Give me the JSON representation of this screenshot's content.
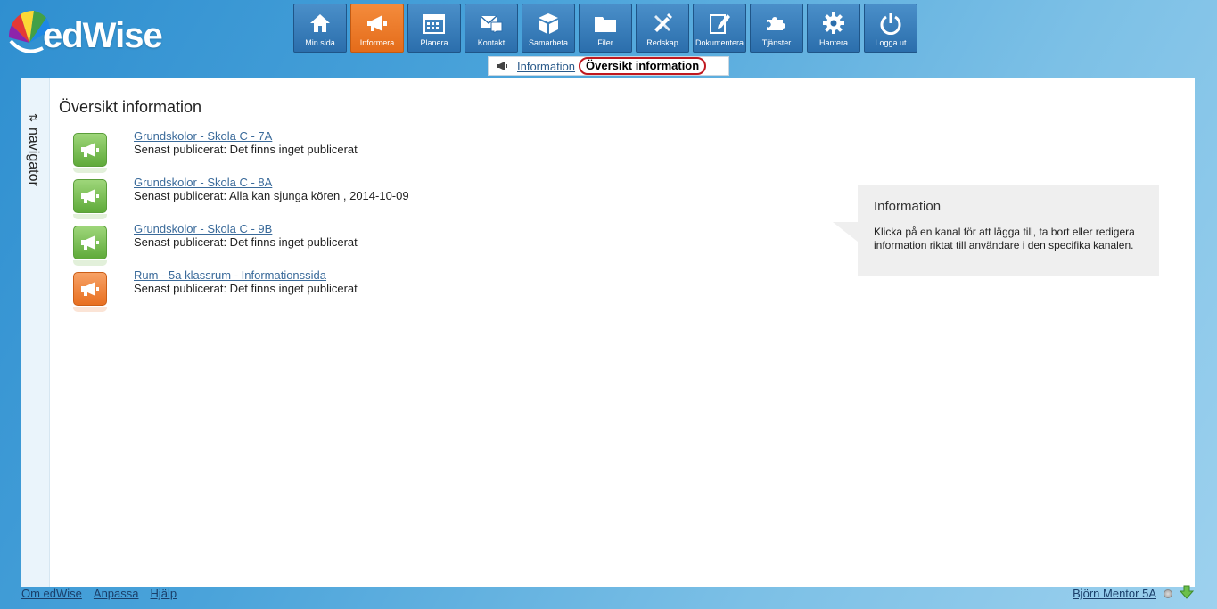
{
  "app": {
    "logo_text": "edWise"
  },
  "topnav": [
    {
      "label": "Min sida",
      "icon": "home-icon",
      "active": false
    },
    {
      "label": "Informera",
      "icon": "megaphone-icon",
      "active": true
    },
    {
      "label": "Planera",
      "icon": "calendar-icon",
      "active": false
    },
    {
      "label": "Kontakt",
      "icon": "mail-icon",
      "active": false
    },
    {
      "label": "Samarbeta",
      "icon": "cube-icon",
      "active": false
    },
    {
      "label": "Filer",
      "icon": "folder-icon",
      "active": false
    },
    {
      "label": "Redskap",
      "icon": "tools-icon",
      "active": false
    },
    {
      "label": "Dokumentera",
      "icon": "edit-document-icon",
      "active": false
    },
    {
      "label": "Tjänster",
      "icon": "puzzle-icon",
      "active": false
    },
    {
      "label": "Hantera",
      "icon": "gear-icon",
      "active": false
    },
    {
      "label": "Logga ut",
      "icon": "power-icon",
      "active": false
    }
  ],
  "breadcrumb": {
    "parent": "Information",
    "current": "Översikt information"
  },
  "navigator": {
    "label": "navigator"
  },
  "main": {
    "title": "Översikt information",
    "channels": [
      {
        "name": "Grundskolor - Skola C - 7A",
        "status": "Senast publicerat: Det finns inget publicerat",
        "color": "green"
      },
      {
        "name": "Grundskolor - Skola C - 8A",
        "status": "Senast publicerat: Alla kan sjunga kören , 2014-10-09",
        "color": "green"
      },
      {
        "name": "Grundskolor - Skola C - 9B",
        "status": "Senast publicerat: Det finns inget publicerat",
        "color": "green"
      },
      {
        "name": "Rum - 5a klassrum - Informationssida",
        "status": "Senast publicerat: Det finns inget publicerat",
        "color": "orange"
      }
    ]
  },
  "infobox": {
    "title": "Information",
    "text": "Klicka på en kanal för att lägga till, ta bort eller redigera information riktat till användare i den specifika kanalen."
  },
  "footer": {
    "links": [
      "Om edWise",
      "Anpassa",
      "Hjälp"
    ],
    "user": "Björn Mentor 5A"
  },
  "colors": {
    "active_nav": "#e86f20",
    "nav": "#2b6eac",
    "channel_green": "#5faa3a",
    "channel_orange": "#e86f20"
  }
}
